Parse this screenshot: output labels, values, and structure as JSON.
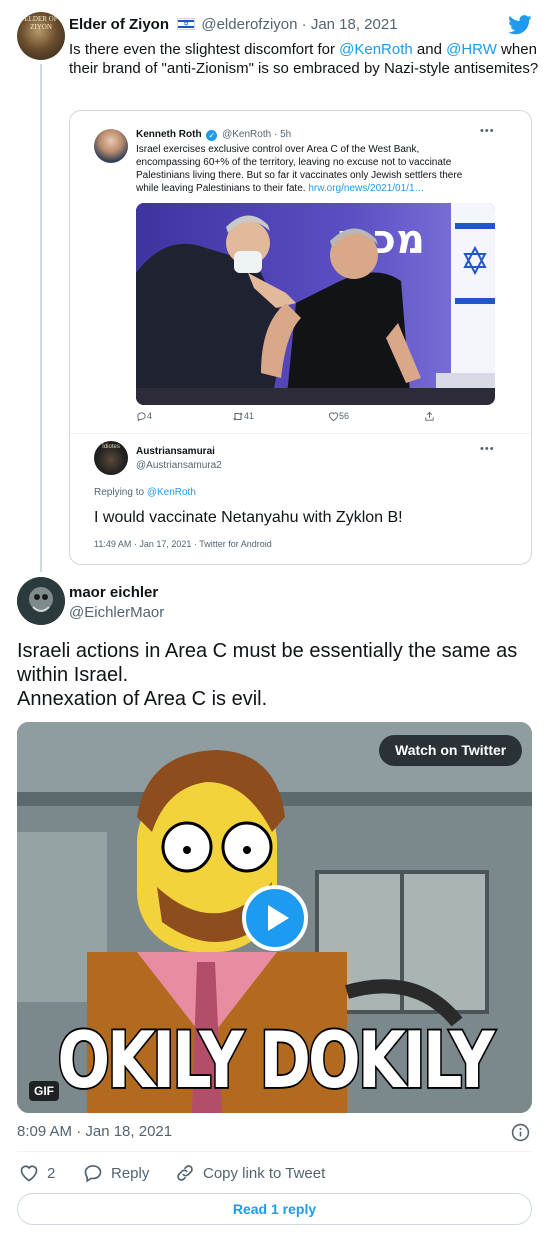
{
  "tweet1": {
    "name": "Elder of Ziyon",
    "avatar_text": "ELDER OF ZIYON",
    "handle": "@elderofziyon",
    "separator": "·",
    "date": "Jan 18, 2021",
    "text_parts": [
      "Is there even the slightest discomfort for ",
      "@KenRoth",
      " and ",
      "@HRW",
      " when their brand of \"anti-Zionism\" is so embraced by Nazi-style antisemites?"
    ]
  },
  "embed": {
    "quoted": {
      "name": "Kenneth Roth",
      "handle": "@KenRoth",
      "separator": "·",
      "age": "5h",
      "text": "Israel exercises exclusive control over Area C of the West Bank, encompassing 60+% of the territory, leaving no excuse not to vaccinate Palestinians living there. But so far it vaccinates only Jewish settlers there while leaving Palestinians to their fate.",
      "link": "hrw.org/news/2021/01/1…",
      "photo_banner_text": "מכבי",
      "counts": {
        "replies": "4",
        "retweets": "41",
        "likes": "56"
      }
    },
    "reply": {
      "name": "Austriansamurai",
      "handle": "@Austriansamura2",
      "avatar_text": "Idiotes",
      "replying_prefix": "Replying to",
      "replying_to": "@KenRoth",
      "text": "I would vaccinate Netanyahu with Zyklon B!",
      "meta": "11:49 AM · Jan 17, 2021 · Twitter for Android"
    }
  },
  "tweet2": {
    "name": "maor eichler",
    "handle": "@EichlerMaor",
    "text_line1": "Israeli actions in Area C must be essentially the same as within Israel.",
    "text_line2": "Annexation of Area C is evil.",
    "media": {
      "watch_label": "Watch on Twitter",
      "gif_label": "GIF",
      "caption": "OKILY DOKILY"
    },
    "timestamp": "8:09 AM · Jan 18, 2021",
    "likes": "2",
    "reply_label": "Reply",
    "copy_label": "Copy link to Tweet",
    "read_replies": "Read 1 reply"
  },
  "colors": {
    "accent": "#1d9bf0",
    "text": "#0f1419",
    "muted": "#536471",
    "border": "#cfd9de"
  }
}
